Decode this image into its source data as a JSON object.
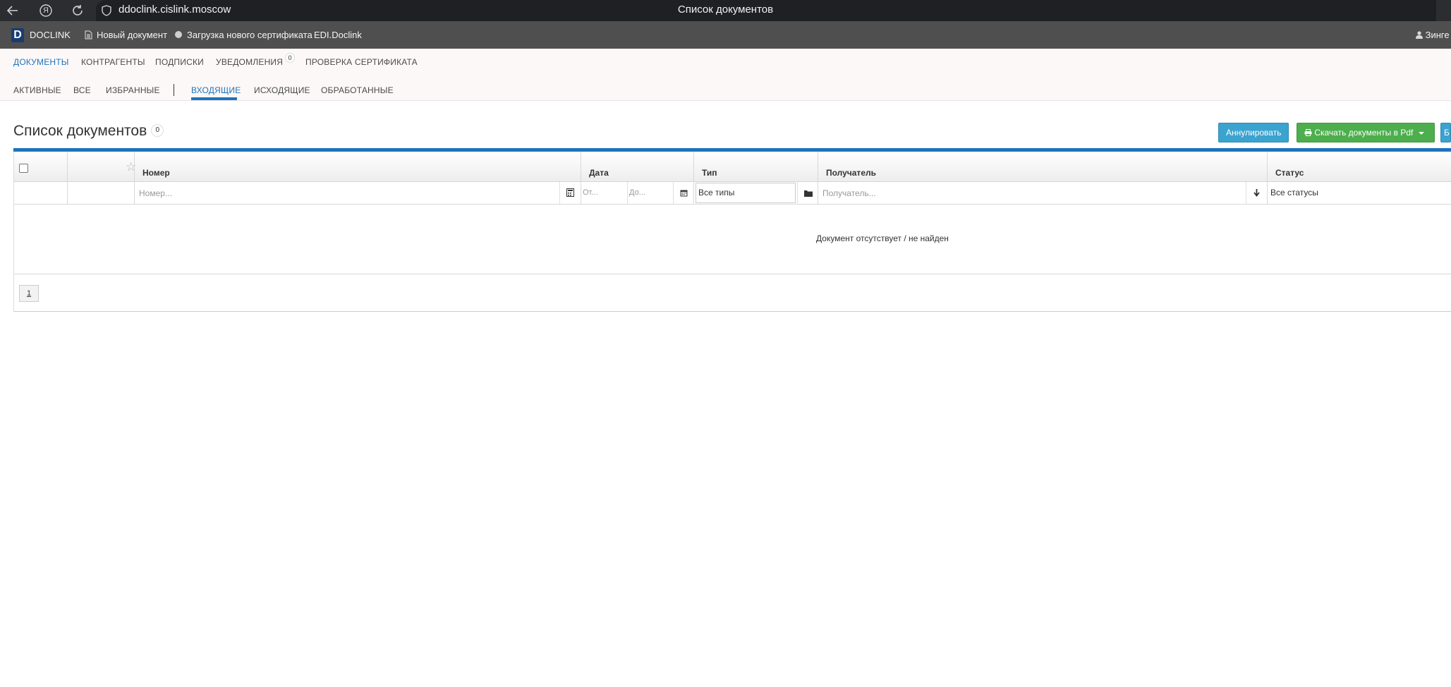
{
  "browser": {
    "url": "ddoclink.cislink.moscow",
    "tab_title": "Список документов",
    "back_icon": "back-arrow-icon",
    "profile_letter": "Я",
    "reload_icon": "reload-icon"
  },
  "app_bar": {
    "logo_letter": "D",
    "brand": "DOCLINK",
    "new_document": "Новый документ",
    "upload_certificate": "Загрузка нового сертификата",
    "edi": "EDI.Doclink",
    "user": "Зинге"
  },
  "main_nav": {
    "items": [
      {
        "label": "ДОКУМЕНТЫ"
      },
      {
        "label": "КОНТРАГЕНТЫ"
      },
      {
        "label": "ПОДПИСКИ"
      },
      {
        "label": "УВЕДОМЛЕНИЯ",
        "badge": "0"
      },
      {
        "label": "ПРОВЕРКА СЕРТИФИКАТА"
      }
    ]
  },
  "sub_nav": {
    "items": [
      {
        "label": "АКТИВНЫЕ"
      },
      {
        "label": "ВСЕ"
      },
      {
        "label": "ИЗБРАННЫЕ"
      },
      {
        "label": "ВХОДЯЩИЕ"
      },
      {
        "label": "ИСХОДЯЩИЕ"
      },
      {
        "label": "ОБРАБОТАННЫЕ"
      }
    ]
  },
  "page": {
    "title": "Список документов",
    "count": "0",
    "annul_button": "Аннулировать",
    "pdf_button": "Скачать документы в Pdf",
    "extra_button": "Б"
  },
  "table": {
    "columns": {
      "number": "Номер",
      "date": "Дата",
      "type": "Тип",
      "recipient": "Получатель",
      "status": "Статус"
    },
    "filters": {
      "number_placeholder": "Номер...",
      "date_from_placeholder": "От...",
      "date_to_placeholder": "До...",
      "type_value": "Все типы",
      "recipient_placeholder": "Получатель...",
      "status_value": "Все статусы"
    },
    "empty_message": "Документ отсутствует / не найден",
    "page_number": "1"
  }
}
